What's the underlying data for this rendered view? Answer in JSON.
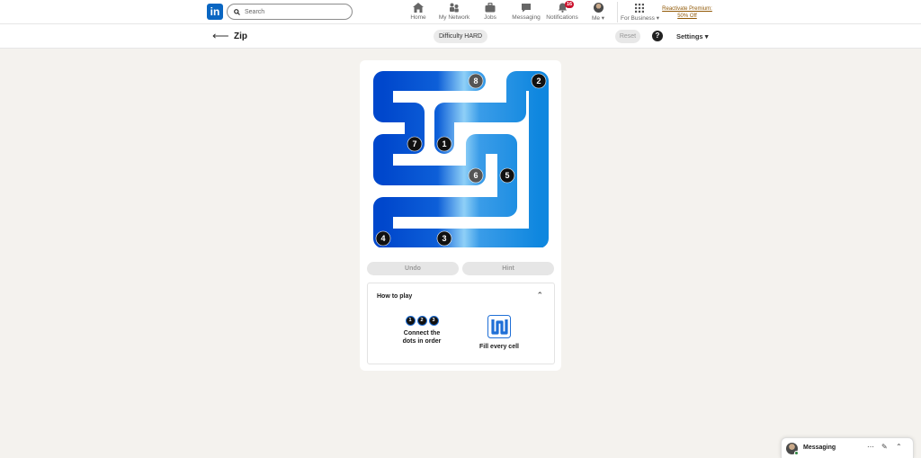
{
  "nav": {
    "logo_text": "in",
    "search_placeholder": "Search",
    "items": [
      {
        "label": "Home",
        "icon": "home-icon"
      },
      {
        "label": "My Network",
        "icon": "network-icon"
      },
      {
        "label": "Jobs",
        "icon": "jobs-icon"
      },
      {
        "label": "Messaging",
        "icon": "messaging-icon"
      },
      {
        "label": "Notifications",
        "icon": "bell-icon",
        "badge": "16"
      },
      {
        "label": "Me",
        "icon": "avatar"
      },
      {
        "label": "For Business",
        "icon": "grid-icon"
      }
    ],
    "premium_line1": "Reactivate Premium:",
    "premium_line2": "50% Off"
  },
  "subheader": {
    "title": "Zip",
    "difficulty": "Difficulty HARD",
    "reset_label": "Reset",
    "help_label": "?",
    "settings_label": "Settings"
  },
  "game": {
    "path_colors": {
      "dark": "#0047cc",
      "mid": "#1d7ee6",
      "light": "#55b6f0"
    },
    "dot_labels": [
      "1",
      "2",
      "3",
      "4",
      "5",
      "6",
      "7",
      "8"
    ],
    "undo_label": "Undo",
    "hint_label": "Hint"
  },
  "howto": {
    "title": "How to play",
    "step1_dots": [
      "1",
      "2",
      "3"
    ],
    "step1_line1": "Connect the",
    "step1_line2": "dots in order",
    "step2_label": "Fill every cell"
  },
  "messaging": {
    "label": "Messaging"
  }
}
